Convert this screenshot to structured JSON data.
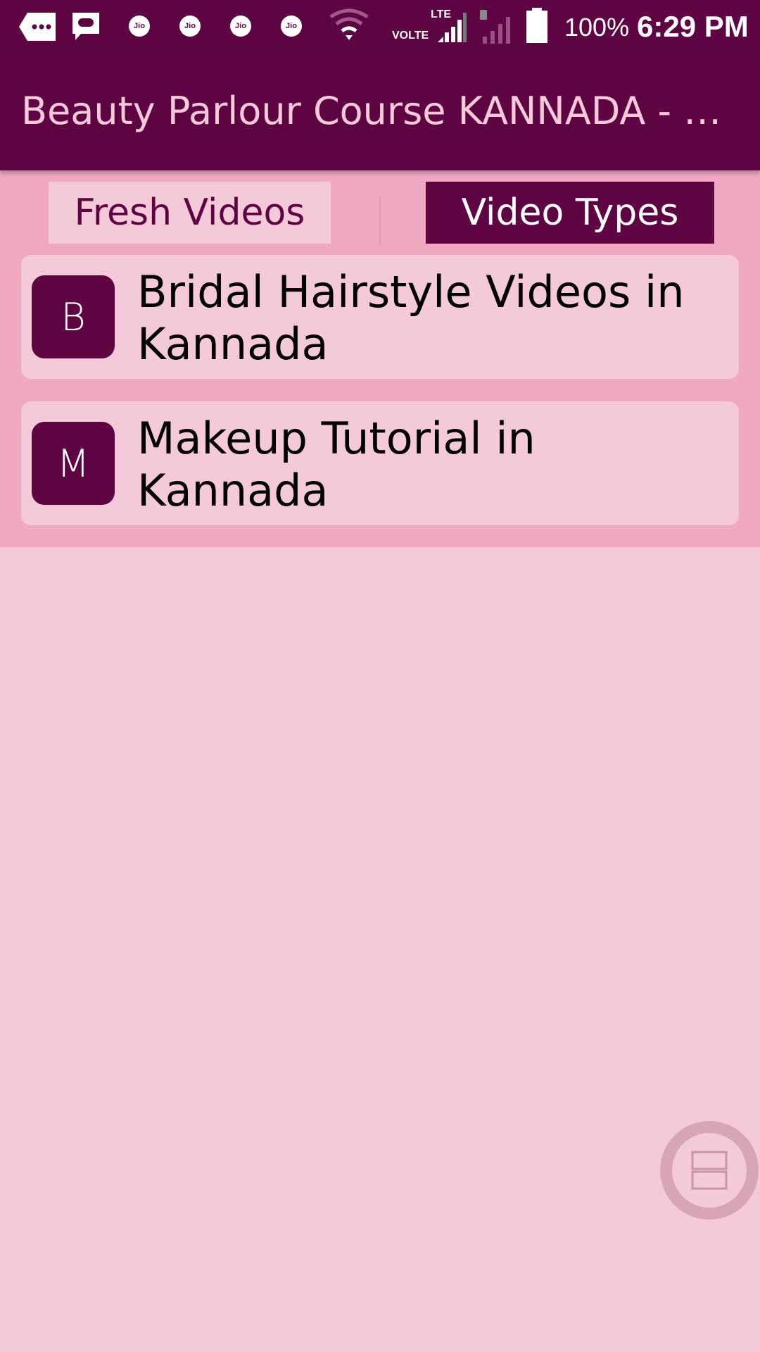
{
  "status_bar": {
    "icons": [
      "notification-more-icon",
      "message-icon",
      "jio-icon",
      "jio-icon",
      "jio-icon",
      "jio-icon",
      "wifi-icon",
      "lte-signal-icon",
      "sim-signal-icon",
      "battery-icon"
    ],
    "jio_label": "Jio",
    "lte_label": "LTE",
    "volte_label": "VOLTE",
    "battery": "100%",
    "time": "6:29 PM"
  },
  "app_bar": {
    "title": "Beauty Parlour Course KANNADA - Parlour Videos"
  },
  "tabs": [
    {
      "label": "Fresh Videos",
      "selected": false
    },
    {
      "label": "Video Types",
      "selected": true
    }
  ],
  "list": [
    {
      "initial": "B",
      "title": "Bridal Hairstyle Videos in Kannada"
    },
    {
      "initial": "M",
      "title": "Makeup Tutorial in Kannada"
    }
  ],
  "fab": {
    "icon": "layout-split-icon"
  },
  "colors": {
    "primary": "#5e0442",
    "background": "#f4cad8",
    "tab_strip": "#efa8c0"
  }
}
